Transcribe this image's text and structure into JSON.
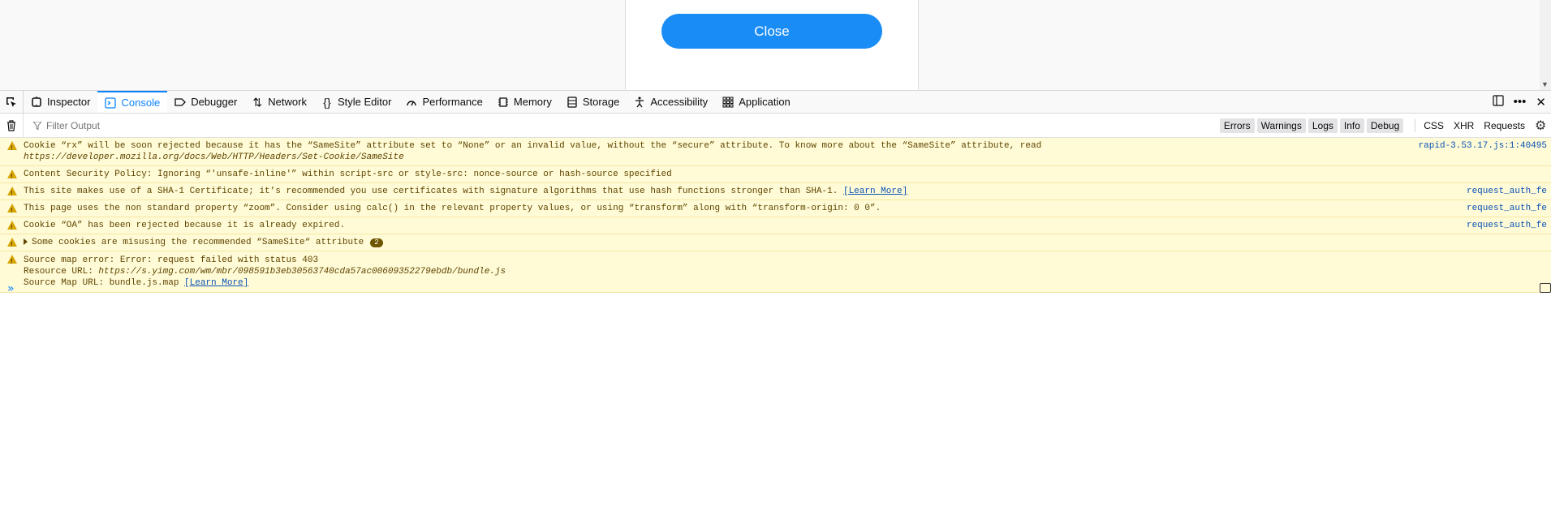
{
  "page": {
    "close_button_label": "Close"
  },
  "devtools": {
    "tabs": [
      {
        "label": "Inspector",
        "icon": "inspector-icon"
      },
      {
        "label": "Console",
        "icon": "console-icon",
        "selected": true
      },
      {
        "label": "Debugger",
        "icon": "debugger-icon"
      },
      {
        "label": "Network",
        "icon": "network-icon"
      },
      {
        "label": "Style Editor",
        "icon": "style-editor-icon"
      },
      {
        "label": "Performance",
        "icon": "performance-icon"
      },
      {
        "label": "Memory",
        "icon": "memory-icon"
      },
      {
        "label": "Storage",
        "icon": "storage-icon"
      },
      {
        "label": "Accessibility",
        "icon": "accessibility-icon"
      },
      {
        "label": "Application",
        "icon": "application-icon"
      }
    ]
  },
  "console": {
    "filter_placeholder": "Filter Output",
    "levels": [
      "Errors",
      "Warnings",
      "Logs",
      "Info",
      "Debug"
    ],
    "requests": [
      "CSS",
      "XHR",
      "Requests"
    ],
    "messages": [
      {
        "text": "Cookie “rx” will be soon rejected because it has the “SameSite” attribute set to “None” or an invalid value, without the “secure” attribute. To know more about the “SameSite” attribute, read ",
        "url": "https://developer.mozilla.org/docs/Web/HTTP/Headers/Set-Cookie/SameSite",
        "source": "rapid-3.53.17.js:1:40495"
      },
      {
        "text": "Content Security Policy: Ignoring “'unsafe-inline'” within script-src or style-src: nonce-source or hash-source specified"
      },
      {
        "text": "This site makes use of a SHA-1 Certificate; it’s recommended you use certificates with signature algorithms that use hash functions stronger than SHA-1. ",
        "link": "[Learn More]",
        "source": "request_auth_fe"
      },
      {
        "text": "This page uses the non standard property “zoom”. Consider using calc() in the relevant property values, or using “transform” along with “transform-origin: 0 0”.",
        "source": "request_auth_fe"
      },
      {
        "text": "Cookie “OA” has been rejected because it is already expired.",
        "source": "request_auth_fe"
      },
      {
        "text": "Some cookies are misusing the recommended “SameSite“ attribute",
        "count": "2"
      },
      {
        "line1": "Source map error: Error: request failed with status 403",
        "line2_label": "Resource URL: ",
        "line2_url": "https://s.yimg.com/wm/mbr/098591b3eb30563740cda57ac00609352279ebdb/bundle.js",
        "line3_label": "Source Map URL: bundle.js.map ",
        "line3_link": "[Learn More]"
      }
    ]
  }
}
